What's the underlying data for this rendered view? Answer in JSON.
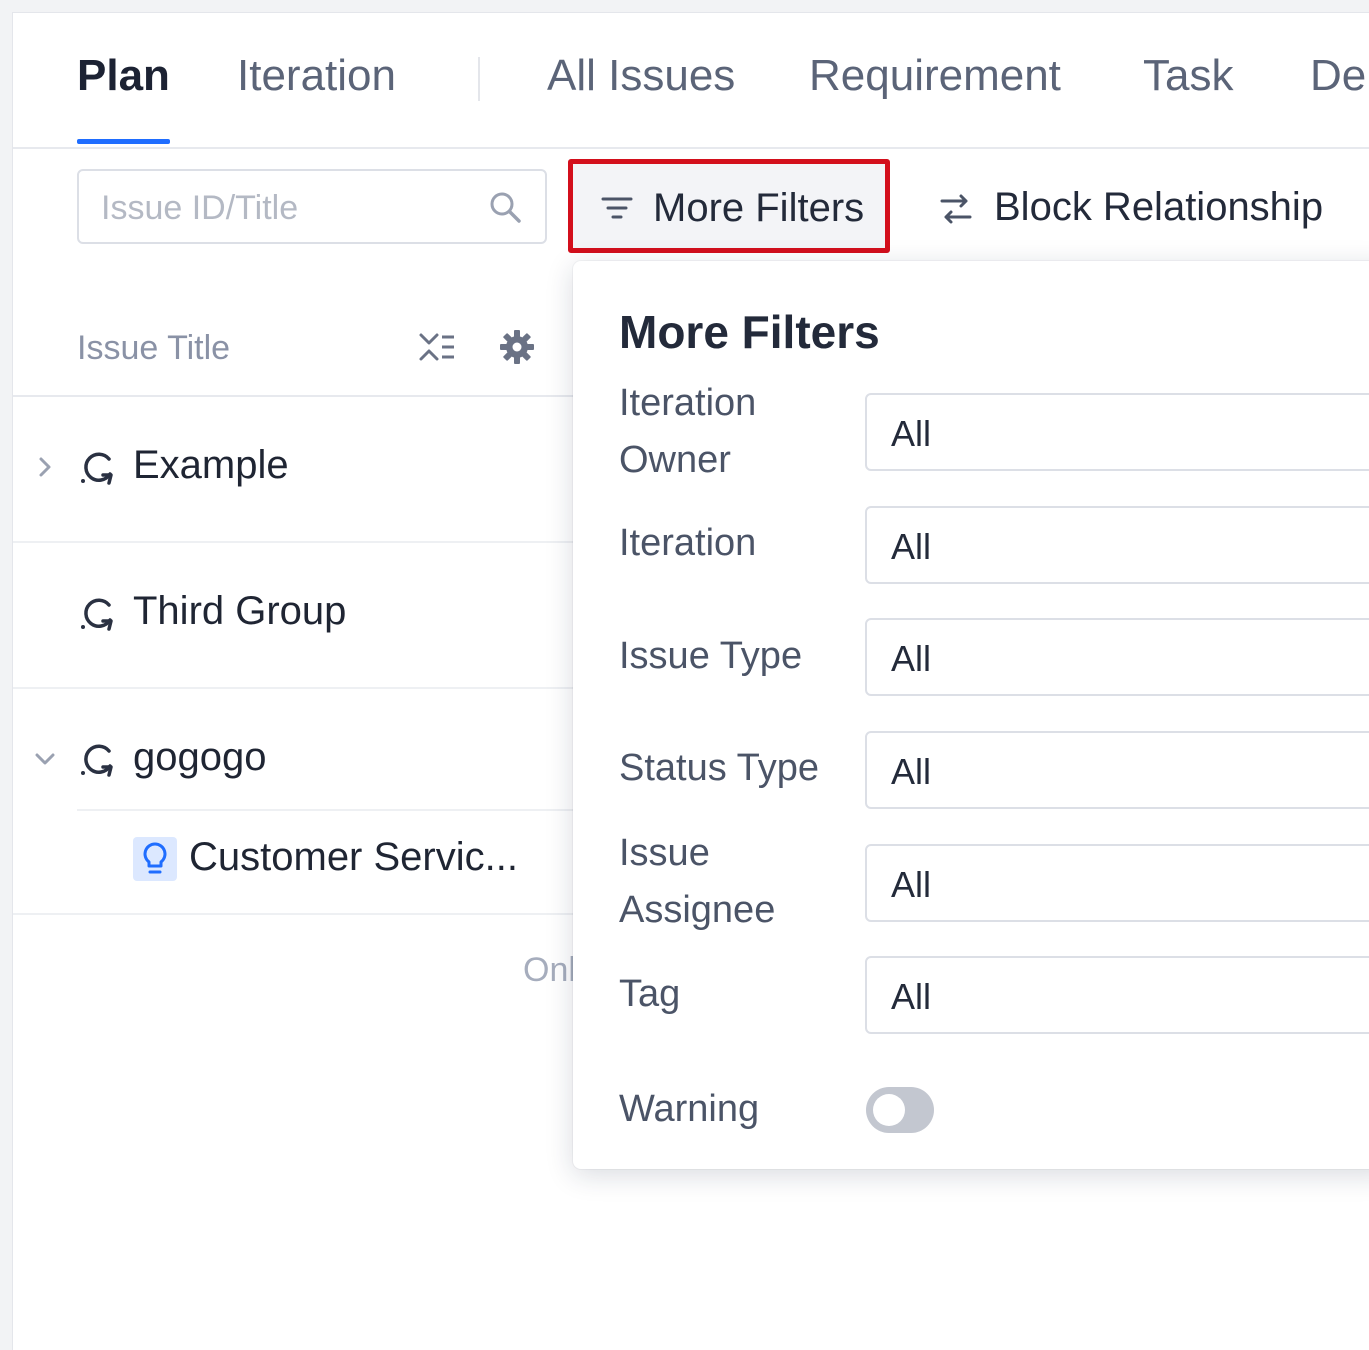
{
  "tabs": [
    {
      "label": "Plan",
      "active": true
    },
    {
      "label": "Iteration",
      "active": false
    },
    {
      "label": "All Issues",
      "active": false
    },
    {
      "label": "Requirement",
      "active": false
    },
    {
      "label": "Task",
      "active": false
    },
    {
      "label": "De",
      "active": false
    }
  ],
  "toolbar": {
    "search_placeholder": "Issue ID/Title",
    "more_filters_label": "More Filters",
    "block_relationship_label": "Block Relationship"
  },
  "list": {
    "header_label": "Issue Title",
    "groups": [
      {
        "label": "Example",
        "expanded": false
      },
      {
        "label": "Third Group",
        "expanded": false
      },
      {
        "label": "gogogo",
        "expanded": true,
        "children": [
          {
            "label": "Customer Servic..."
          }
        ]
      }
    ],
    "footer_partial": "Onl"
  },
  "filters": {
    "title": "More Filters",
    "fields": [
      {
        "label": "Iteration Owner",
        "value": "All"
      },
      {
        "label": "Iteration",
        "value": "All"
      },
      {
        "label": "Issue Type",
        "value": "All"
      },
      {
        "label": "Status Type",
        "value": "All"
      },
      {
        "label": "Issue Assignee",
        "value": "All"
      },
      {
        "label": "Tag",
        "value": "All"
      }
    ],
    "warning_label": "Warning",
    "warning_enabled": false
  },
  "colors": {
    "accent": "#1f6dff",
    "highlight_border": "#d30f1c",
    "toggle_off": "#c3c7d0"
  }
}
